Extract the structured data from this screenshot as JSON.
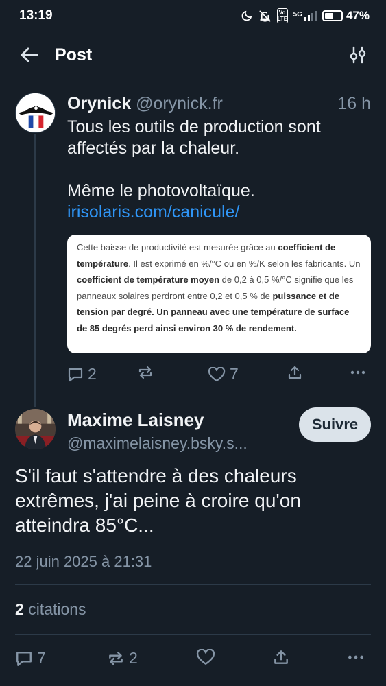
{
  "status_bar": {
    "time": "13:19",
    "network": "5G",
    "volte": "Vo LTE",
    "battery_pct": "47%",
    "battery_level": 0.47
  },
  "header": {
    "title": "Post"
  },
  "post1": {
    "author_name": "Orynick",
    "author_handle": "@orynick.fr",
    "time": "16 h",
    "text_line1": "Tous les outils de production sont affectés par la chaleur.",
    "text_line2": "Même le photovoltaïque.",
    "link": "irisolaris.com/canicule/",
    "embed": {
      "p1": "Cette baisse de productivité est mesurée grâce au ",
      "b1": "coefficient de température",
      "p2": ". Il est exprimé en %/°C ou en %/K selon les fabricants. Un ",
      "b2": "coefficient de température moyen",
      "p3": " de 0,2 à 0,5 %/°C signifie que les panneaux solaires perdront entre 0,2 et 0,5 % de ",
      "b3": "puissance et de tension par degré. Un panneau avec une température de surface de 85 degrés perd ainsi environ 30 % de rendement."
    },
    "actions": {
      "replies": "2",
      "reposts": "",
      "likes": "7"
    }
  },
  "post2": {
    "author_name": "Maxime Laisney",
    "author_handle": "@maximelaisney.bsky.s...",
    "follow_label": "Suivre",
    "text": "S'il faut s'attendre à des chaleurs extrêmes, j'ai peine à croire qu'on atteindra 85°C...",
    "date": "22 juin 2025 à 21:31",
    "citations_count": "2",
    "citations_label": "citations",
    "actions": {
      "replies": "7",
      "reposts": "2",
      "likes": ""
    }
  },
  "colors": {
    "background": "#161e27",
    "text": "#f1f3f5",
    "muted": "#8595a6",
    "link": "#2f95f5",
    "follow_bg": "#dbe3ea"
  }
}
